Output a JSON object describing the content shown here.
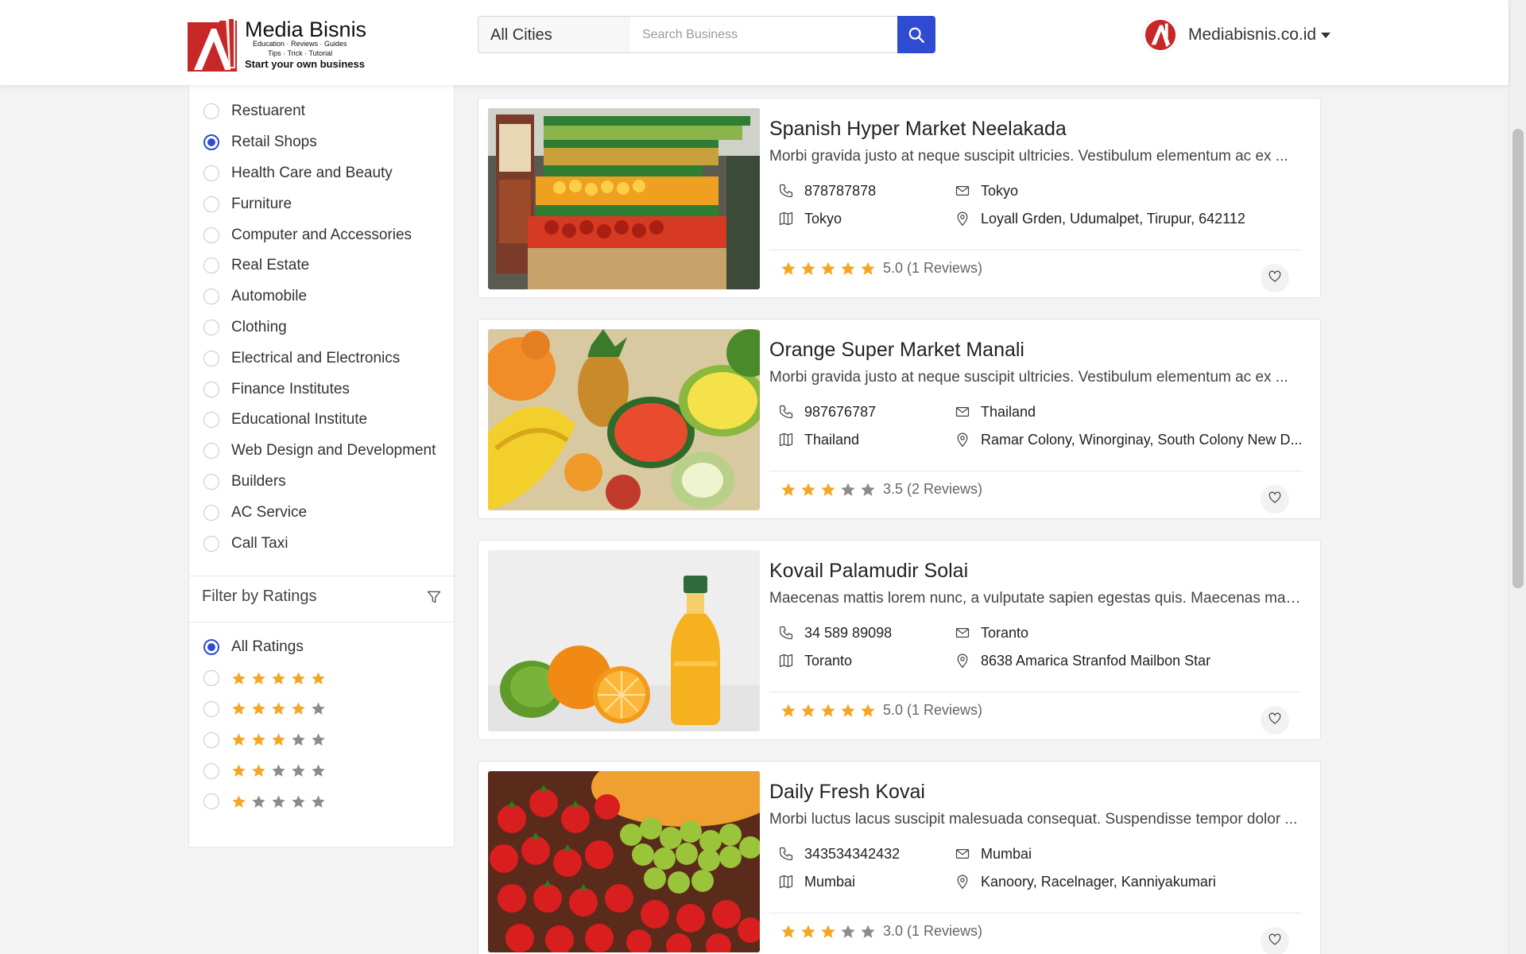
{
  "brand": {
    "title": "Media Bisnis",
    "sub_line1": "Education · Reviews · Guides",
    "sub_line2": "Tips · Trick · Tutorial",
    "tagline": "Start your own business",
    "accent": "#c62828"
  },
  "search": {
    "city": "All Cities",
    "placeholder": "Search Business",
    "button_color": "#2e4bd1"
  },
  "account": {
    "name": "Mediabisnis.co.id"
  },
  "categories": [
    {
      "label": "Restuarent",
      "checked": false
    },
    {
      "label": "Retail Shops",
      "checked": true
    },
    {
      "label": "Health Care and Beauty",
      "checked": false
    },
    {
      "label": "Furniture",
      "checked": false
    },
    {
      "label": "Computer and Accessories",
      "checked": false
    },
    {
      "label": "Real Estate",
      "checked": false
    },
    {
      "label": "Automobile",
      "checked": false
    },
    {
      "label": "Clothing",
      "checked": false
    },
    {
      "label": "Electrical and Electronics",
      "checked": false
    },
    {
      "label": "Finance Institutes",
      "checked": false
    },
    {
      "label": "Educational Institute",
      "checked": false
    },
    {
      "label": "Web Design and Development",
      "checked": false
    },
    {
      "label": "Builders",
      "checked": false
    },
    {
      "label": "AC Service",
      "checked": false
    },
    {
      "label": "Call Taxi",
      "checked": false
    }
  ],
  "ratings_filter": {
    "title": "Filter by Ratings",
    "all_label": "All Ratings",
    "options": [
      5,
      4,
      3,
      2,
      1
    ]
  },
  "colors": {
    "star_filled": "#f5a623",
    "star_empty": "#8c8c8c"
  },
  "listings": [
    {
      "title": "Spanish Hyper Market Neelakada",
      "description": "Morbi gravida justo at neque suscipit ultricies. Vestibulum elementum ac ex ...",
      "phone": "878787878",
      "email": "Tokyo",
      "city": "Tokyo",
      "address": "Loyall Grden, Udumalpet, Tirupur, 642112",
      "stars": 5,
      "rating_text": "5.0 (1 Reviews)",
      "image": "market-produce-image"
    },
    {
      "title": "Orange Super Market Manali",
      "description": "Morbi gravida justo at neque suscipit ultricies. Vestibulum elementum ac ex ...",
      "phone": "987676787",
      "email": "Thailand",
      "city": "Thailand",
      "address": "Ramar Colony, Winorginay, South Colony New D...",
      "stars": 3,
      "rating_text": "3.5 (2 Reviews)",
      "image": "tropical-fruits-image"
    },
    {
      "title": "Kovail Palamudir Solai",
      "description": "Maecenas mattis lorem nunc, a vulputate sapien egestas quis. Maecenas mas...",
      "phone": "34 589 89098",
      "email": "Toranto",
      "city": "Toranto",
      "address": "8638 Amarica Stranfod Mailbon Star",
      "stars": 5,
      "rating_text": "5.0 (1 Reviews)",
      "image": "orange-juice-image"
    },
    {
      "title": "Daily Fresh Kovai",
      "description": "Morbi luctus lacus suscipit malesuada consequat. Suspendisse tempor dolor ...",
      "phone": "343534342432",
      "email": "Mumbai",
      "city": "Mumbai",
      "address": "Kanoory, Racelnager, Kanniyakumari",
      "stars": 3,
      "rating_text": "3.0 (1 Reviews)",
      "image": "berries-grapes-image"
    }
  ]
}
